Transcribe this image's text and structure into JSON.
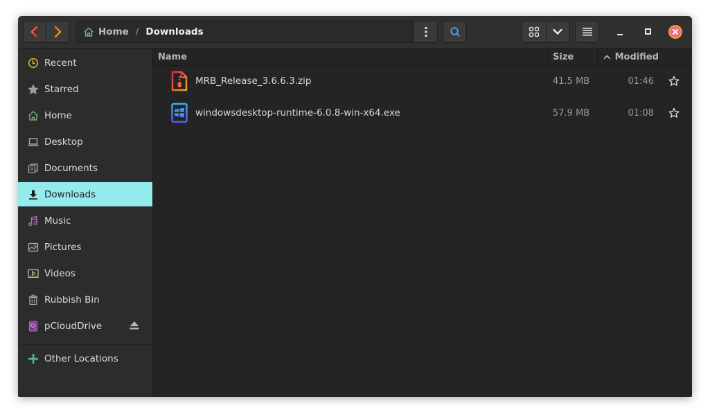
{
  "window": {
    "title": "Downloads"
  },
  "headerbar": {
    "back_icon": "chevron-left-icon",
    "forward_icon": "chevron-right-icon",
    "path": {
      "home_icon": "home-icon",
      "home_label": "Home",
      "separator": "/",
      "current": "Downloads"
    },
    "path_menu_icon": "kebab-menu-icon",
    "search_icon": "search-icon",
    "view_grid_icon": "grid-icon",
    "view_options_icon": "chevron-down-icon",
    "main_menu_icon": "hamburger-icon",
    "minimize_icon": "minimize-icon",
    "maximize_icon": "maximize-icon",
    "close_icon": "close-icon"
  },
  "sidebar": {
    "items": [
      {
        "label": "Recent",
        "icon": "clock-icon",
        "color": "#d4a72c"
      },
      {
        "label": "Starred",
        "icon": "star-icon",
        "color": "#9e9e9e"
      },
      {
        "label": "Home",
        "icon": "home-icon",
        "color": "#73b27a"
      },
      {
        "label": "Desktop",
        "icon": "laptop-icon",
        "color": "#a8a8a8"
      },
      {
        "label": "Documents",
        "icon": "documents-icon",
        "color": "#a8a8a8"
      },
      {
        "label": "Downloads",
        "icon": "download-icon",
        "color": "#1b1b1b",
        "active": true
      },
      {
        "label": "Music",
        "icon": "music-icon",
        "color": "#a66bc4"
      },
      {
        "label": "Pictures",
        "icon": "pictures-icon",
        "color": "#a8a8a8"
      },
      {
        "label": "Videos",
        "icon": "videos-icon",
        "color": "#c8b48c"
      },
      {
        "label": "Rubbish Bin",
        "icon": "trash-icon",
        "color": "#a8a8a8"
      },
      {
        "label": "pCloudDrive",
        "icon": "drive-icon",
        "color": "#9b4fa8"
      }
    ],
    "eject_icon": "eject-icon",
    "other_locations": {
      "label": "Other Locations",
      "icon": "plus-icon",
      "color": "#4cbf8c"
    }
  },
  "file_list": {
    "columns": {
      "name": "Name",
      "size": "Size",
      "modified": "Modified",
      "sort_icon": "chevron-up-icon"
    },
    "rows": [
      {
        "name": "MRB_Release_3.6.6.3.zip",
        "size": "41.5 MB",
        "modified": "01:46",
        "icon": "zip-archive-icon"
      },
      {
        "name": "windowsdesktop-runtime-6.0.8-win-x64.exe",
        "size": "57.9 MB",
        "modified": "01:08",
        "icon": "windows-exe-icon"
      }
    ]
  },
  "colors": {
    "accent": "#94ebeb",
    "search_icon": "#4aa3f0",
    "close_button": "#f06b8a"
  }
}
